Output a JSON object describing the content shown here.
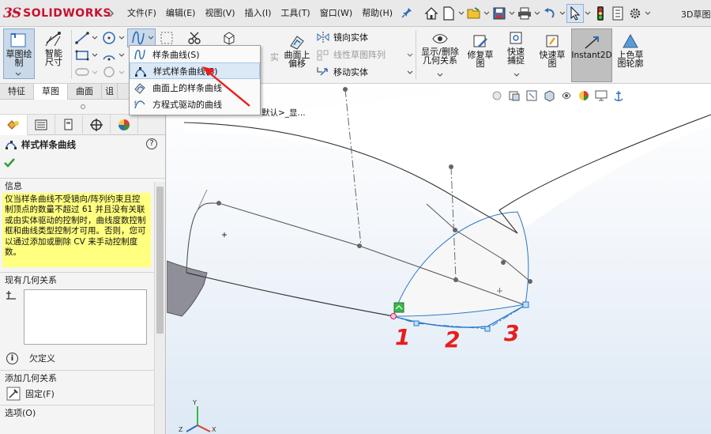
{
  "app": {
    "logo_mark": "3S",
    "logo_text": "SOLIDWORKS",
    "document_title": "3D草图"
  },
  "menu": [
    "文件(F)",
    "编辑(E)",
    "视图(V)",
    "插入(I)",
    "工具(T)",
    "窗口(W)",
    "帮助(H)"
  ],
  "commands": {
    "sketch": "草图绘制",
    "smart_dim": "智能尺寸",
    "mirror_entities": "镜向实体",
    "linear_pattern": "线性草图阵列",
    "move_entities": "移动实体",
    "offset_on_surface": "曲面上偏移",
    "convert_partial": "实",
    "show_delete_relations": "显示/删除几何关系",
    "repair_sketch": "修复草图",
    "quick_snaps": "快速捕捉",
    "rapid_sketch": "快速草图",
    "instant2d": "Instant2D",
    "shaded_sketch": "上色草图轮廓"
  },
  "tabs": [
    {
      "label": "特征",
      "active": false
    },
    {
      "label": "草图",
      "active": true
    },
    {
      "label": "曲面",
      "active": false
    },
    {
      "label": "诅",
      "active": false
    }
  ],
  "spline_menu": [
    {
      "label": "样条曲线(S)",
      "icon": "spline-icon",
      "highlighted": false
    },
    {
      "label": "样式样条曲线(S)",
      "icon": "style-spline-icon",
      "highlighted": true
    },
    {
      "label": "曲面上的样条曲线",
      "icon": "spline-on-surface-icon",
      "highlighted": false
    },
    {
      "label": "方程式驱动的曲线",
      "icon": "equation-curve-icon",
      "highlighted": false
    }
  ],
  "property_manager": {
    "title": "样式样条曲线",
    "help": "?",
    "info_header": "信息",
    "info_text": "仅当样条曲线不受镜向/阵列约束且控制顶点的数量不超过 61 并且没有关联或由实体驱动的控制时，曲线度数控制框和曲线类型控制才可用。否则，您可以通过添加或删除 CV 来手动控制度数。",
    "existing_relations_header": "现有几何关系",
    "status_text": "欠定义",
    "add_relations_header": "添加几何关系",
    "fix_label": "固定(F)",
    "options_header": "选项(O)"
  },
  "viewport": {
    "breadcrumb": "默认>_显..."
  },
  "annotations": [
    "1",
    "2",
    "3"
  ],
  "colors": {
    "accent_red": "#e81d1d",
    "highlight_blue": "#dbe9f7",
    "info_yellow": "#ffff80",
    "curve_blue": "#2a79c9"
  }
}
